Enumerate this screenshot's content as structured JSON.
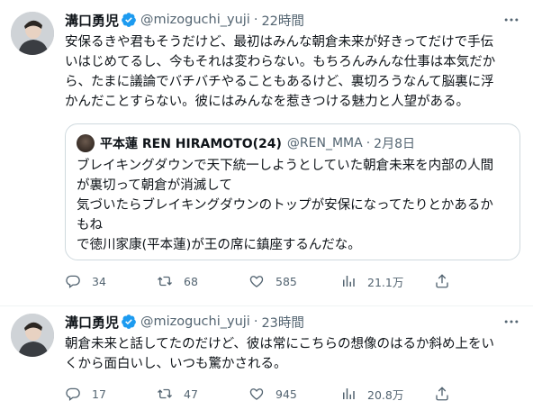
{
  "tweets": [
    {
      "display_name": "溝口勇児",
      "handle": "@mizoguchi_yuji",
      "separator": "·",
      "time": "22時間",
      "text_lines": [
        "安保るきや君もそうだけど、最初はみんな朝倉未来が好きってだけで手伝",
        "いはじめてるし、今もそれは変わらない。もちろんみんな仕事は本気だか",
        "ら、たまに議論でバチバチやることもあるけど、裏切ろうなんて脳裏に浮",
        "かんだことすらない。彼にはみんなを惹きつける魅力と人望がある。"
      ],
      "quote": {
        "display_name": "平本蓮 REN HIRAMOTO(24)",
        "handle": "@REN_MMA",
        "separator": "·",
        "time": "2月8日",
        "text_lines": [
          "ブレイキングダウンで天下統一しようとしていた朝倉未来を内部の人間",
          "が裏切って朝倉が消滅して",
          "気づいたらブレイキングダウンのトップが安保になってたりとかあるか",
          "もね",
          "で徳川家康(平本蓮)が王の席に鎮座するんだな。"
        ]
      },
      "stats": {
        "replies": "34",
        "retweets": "68",
        "likes": "585",
        "views": "21.1万"
      }
    },
    {
      "display_name": "溝口勇児",
      "handle": "@mizoguchi_yuji",
      "separator": "·",
      "time": "23時間",
      "text_lines": [
        "朝倉未来と話してたのだけど、彼は常にこちらの想像のはるか斜め上をい",
        "くから面白いし、いつも驚かされる。"
      ],
      "stats": {
        "replies": "17",
        "retweets": "47",
        "likes": "945",
        "views": "20.8万"
      }
    }
  ],
  "colors": {
    "verified": "#1d9bf0",
    "text": "#0f1419",
    "secondary": "#536471",
    "border": "#cfd9de"
  },
  "icons": [
    "verified-badge-icon",
    "more-icon",
    "reply-icon",
    "retweet-icon",
    "like-icon",
    "views-icon",
    "share-icon"
  ]
}
